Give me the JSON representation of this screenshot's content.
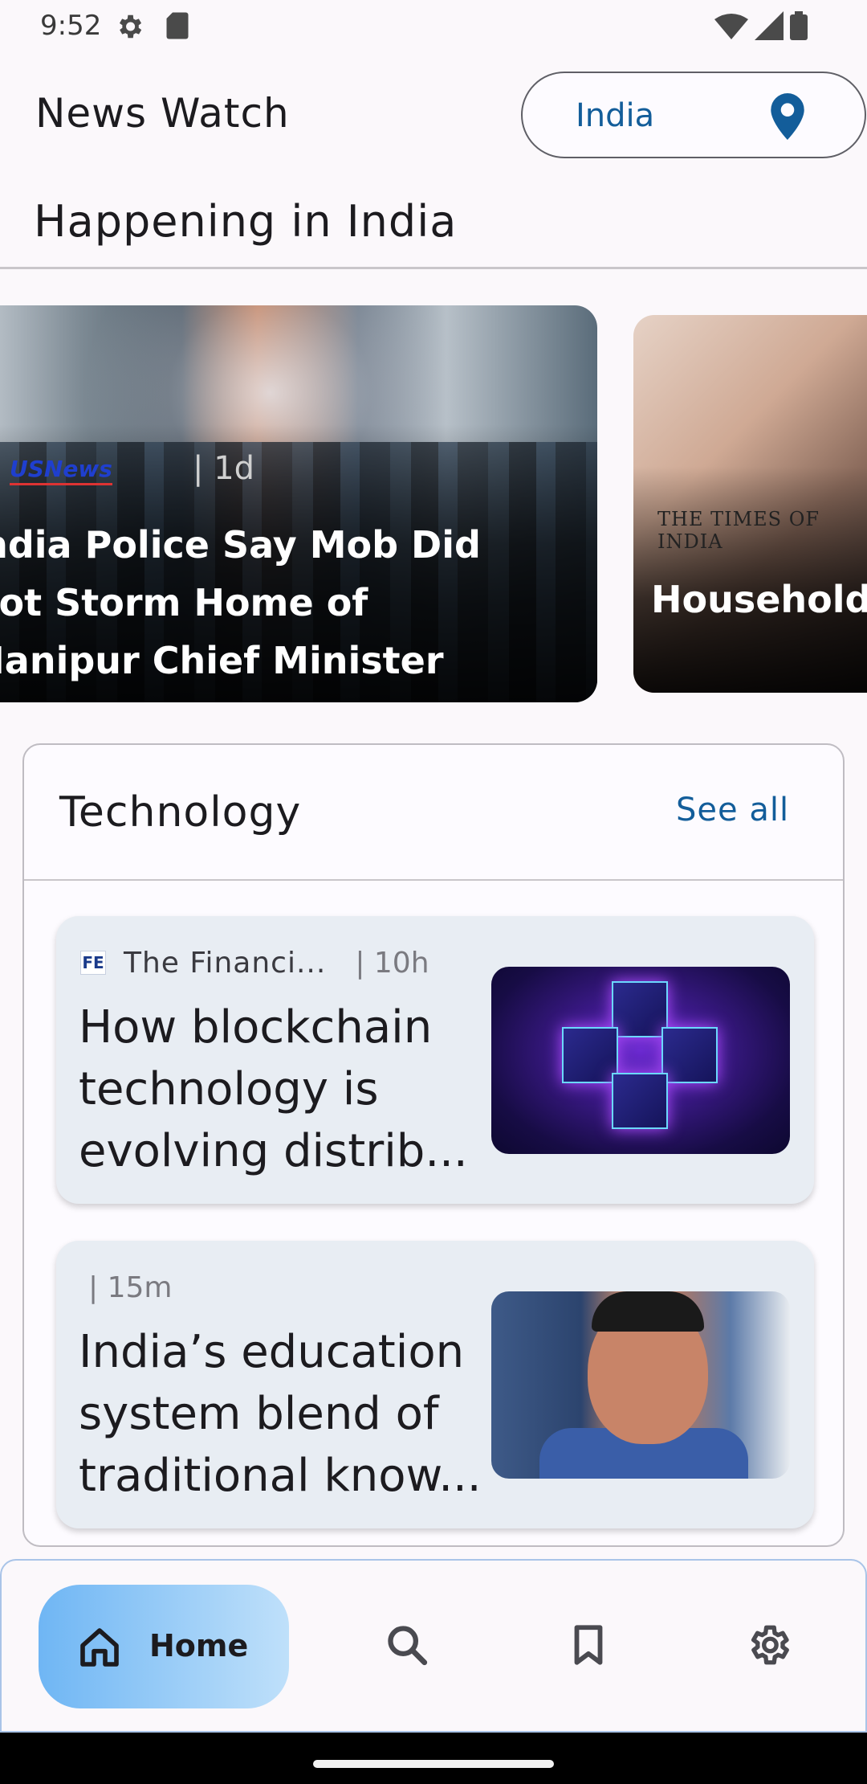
{
  "status_bar": {
    "time": "9:52"
  },
  "header": {
    "app_title": "News Watch",
    "location": "India"
  },
  "section": {
    "heading": "Happening in India"
  },
  "carousel": [
    {
      "source_logo": "USNews",
      "time": "| 1d",
      "title": "India Police Say Mob Did Not Storm Home of Manipur Chief Minister"
    },
    {
      "source_logo": "THE TIMES OF INDIA",
      "title": "Household s… low threaten…"
    }
  ],
  "technology": {
    "title": "Technology",
    "see_all": "See all",
    "articles": [
      {
        "source_logo": "FE",
        "source": "The Financi...",
        "time": "| 10h",
        "title": "How blockchain technology is evolving distrib..."
      },
      {
        "source": "",
        "time": "| 15m",
        "title": "India’s education system blend of traditional know..."
      }
    ]
  },
  "bottom_nav": {
    "home": "Home",
    "items": [
      "search-icon",
      "bookmark-icon",
      "settings-icon"
    ]
  },
  "colors": {
    "accent": "#135d9a",
    "nav_active": "#8cc7f6"
  }
}
